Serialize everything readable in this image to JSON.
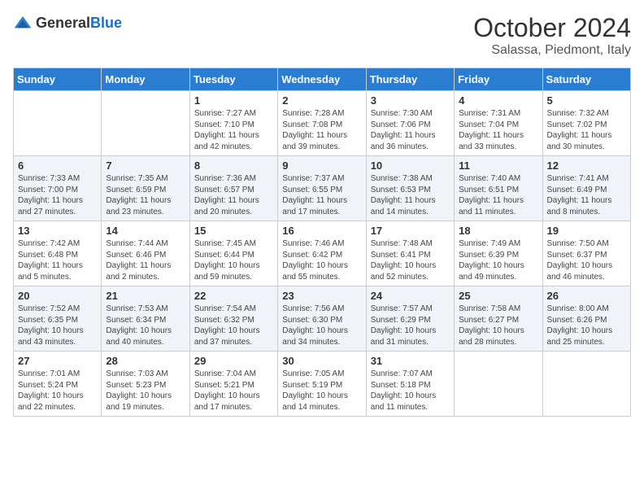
{
  "header": {
    "logo_general": "General",
    "logo_blue": "Blue",
    "month_title": "October 2024",
    "location": "Salassa, Piedmont, Italy"
  },
  "days_of_week": [
    "Sunday",
    "Monday",
    "Tuesday",
    "Wednesday",
    "Thursday",
    "Friday",
    "Saturday"
  ],
  "weeks": [
    [
      {
        "day": "",
        "info": ""
      },
      {
        "day": "",
        "info": ""
      },
      {
        "day": "1",
        "info": "Sunrise: 7:27 AM\nSunset: 7:10 PM\nDaylight: 11 hours and 42 minutes."
      },
      {
        "day": "2",
        "info": "Sunrise: 7:28 AM\nSunset: 7:08 PM\nDaylight: 11 hours and 39 minutes."
      },
      {
        "day": "3",
        "info": "Sunrise: 7:30 AM\nSunset: 7:06 PM\nDaylight: 11 hours and 36 minutes."
      },
      {
        "day": "4",
        "info": "Sunrise: 7:31 AM\nSunset: 7:04 PM\nDaylight: 11 hours and 33 minutes."
      },
      {
        "day": "5",
        "info": "Sunrise: 7:32 AM\nSunset: 7:02 PM\nDaylight: 11 hours and 30 minutes."
      }
    ],
    [
      {
        "day": "6",
        "info": "Sunrise: 7:33 AM\nSunset: 7:00 PM\nDaylight: 11 hours and 27 minutes."
      },
      {
        "day": "7",
        "info": "Sunrise: 7:35 AM\nSunset: 6:59 PM\nDaylight: 11 hours and 23 minutes."
      },
      {
        "day": "8",
        "info": "Sunrise: 7:36 AM\nSunset: 6:57 PM\nDaylight: 11 hours and 20 minutes."
      },
      {
        "day": "9",
        "info": "Sunrise: 7:37 AM\nSunset: 6:55 PM\nDaylight: 11 hours and 17 minutes."
      },
      {
        "day": "10",
        "info": "Sunrise: 7:38 AM\nSunset: 6:53 PM\nDaylight: 11 hours and 14 minutes."
      },
      {
        "day": "11",
        "info": "Sunrise: 7:40 AM\nSunset: 6:51 PM\nDaylight: 11 hours and 11 minutes."
      },
      {
        "day": "12",
        "info": "Sunrise: 7:41 AM\nSunset: 6:49 PM\nDaylight: 11 hours and 8 minutes."
      }
    ],
    [
      {
        "day": "13",
        "info": "Sunrise: 7:42 AM\nSunset: 6:48 PM\nDaylight: 11 hours and 5 minutes."
      },
      {
        "day": "14",
        "info": "Sunrise: 7:44 AM\nSunset: 6:46 PM\nDaylight: 11 hours and 2 minutes."
      },
      {
        "day": "15",
        "info": "Sunrise: 7:45 AM\nSunset: 6:44 PM\nDaylight: 10 hours and 59 minutes."
      },
      {
        "day": "16",
        "info": "Sunrise: 7:46 AM\nSunset: 6:42 PM\nDaylight: 10 hours and 55 minutes."
      },
      {
        "day": "17",
        "info": "Sunrise: 7:48 AM\nSunset: 6:41 PM\nDaylight: 10 hours and 52 minutes."
      },
      {
        "day": "18",
        "info": "Sunrise: 7:49 AM\nSunset: 6:39 PM\nDaylight: 10 hours and 49 minutes."
      },
      {
        "day": "19",
        "info": "Sunrise: 7:50 AM\nSunset: 6:37 PM\nDaylight: 10 hours and 46 minutes."
      }
    ],
    [
      {
        "day": "20",
        "info": "Sunrise: 7:52 AM\nSunset: 6:35 PM\nDaylight: 10 hours and 43 minutes."
      },
      {
        "day": "21",
        "info": "Sunrise: 7:53 AM\nSunset: 6:34 PM\nDaylight: 10 hours and 40 minutes."
      },
      {
        "day": "22",
        "info": "Sunrise: 7:54 AM\nSunset: 6:32 PM\nDaylight: 10 hours and 37 minutes."
      },
      {
        "day": "23",
        "info": "Sunrise: 7:56 AM\nSunset: 6:30 PM\nDaylight: 10 hours and 34 minutes."
      },
      {
        "day": "24",
        "info": "Sunrise: 7:57 AM\nSunset: 6:29 PM\nDaylight: 10 hours and 31 minutes."
      },
      {
        "day": "25",
        "info": "Sunrise: 7:58 AM\nSunset: 6:27 PM\nDaylight: 10 hours and 28 minutes."
      },
      {
        "day": "26",
        "info": "Sunrise: 8:00 AM\nSunset: 6:26 PM\nDaylight: 10 hours and 25 minutes."
      }
    ],
    [
      {
        "day": "27",
        "info": "Sunrise: 7:01 AM\nSunset: 5:24 PM\nDaylight: 10 hours and 22 minutes."
      },
      {
        "day": "28",
        "info": "Sunrise: 7:03 AM\nSunset: 5:23 PM\nDaylight: 10 hours and 19 minutes."
      },
      {
        "day": "29",
        "info": "Sunrise: 7:04 AM\nSunset: 5:21 PM\nDaylight: 10 hours and 17 minutes."
      },
      {
        "day": "30",
        "info": "Sunrise: 7:05 AM\nSunset: 5:19 PM\nDaylight: 10 hours and 14 minutes."
      },
      {
        "day": "31",
        "info": "Sunrise: 7:07 AM\nSunset: 5:18 PM\nDaylight: 10 hours and 11 minutes."
      },
      {
        "day": "",
        "info": ""
      },
      {
        "day": "",
        "info": ""
      }
    ]
  ]
}
